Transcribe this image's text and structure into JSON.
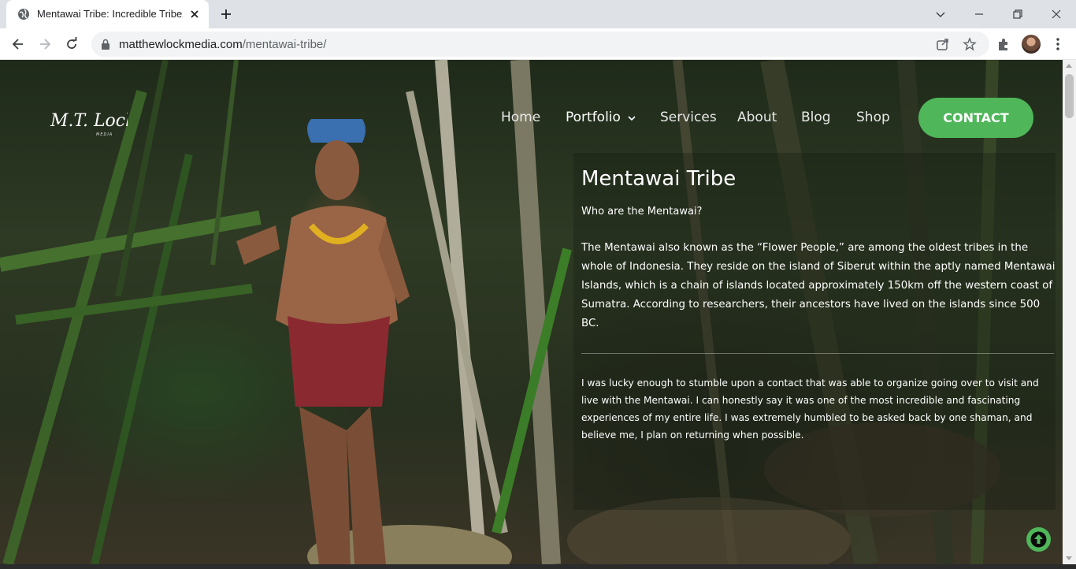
{
  "browser": {
    "tab_title": "Mentawai Tribe: Incredible Tribes",
    "url_host": "matthewlockmedia.com",
    "url_path": "/mentawai-tribe/"
  },
  "site": {
    "logo_text": "M.T. Lock",
    "logo_subtext": "MEDIA",
    "nav": {
      "home": "Home",
      "portfolio": "Portfolio",
      "services": "Services",
      "about": "About",
      "blog": "Blog",
      "shop": "Shop",
      "contact": "CONTACT"
    },
    "accent_color": "#4fb65a"
  },
  "content": {
    "title": "Mentawai Tribe",
    "subheading": "Who are the Mentawai?",
    "paragraph1": "The Mentawai also known as the “Flower People,” are among the oldest tribes in the whole of Indonesia. They reside on the island of Siberut within the aptly named Mentawai Islands, which is a chain of islands located approximately 150km off the western coast of Sumatra. According to researchers, their ancestors have lived on the islands since 500 BC.",
    "paragraph2": "I was lucky enough to stumble upon a contact that was able to organize going over to visit and live with the Mentawai. I can honestly say it was one of the most incredible and fascinating experiences of my entire life. I was extremely humbled to be asked back by one shaman, and believe me, I plan on returning when possible."
  }
}
